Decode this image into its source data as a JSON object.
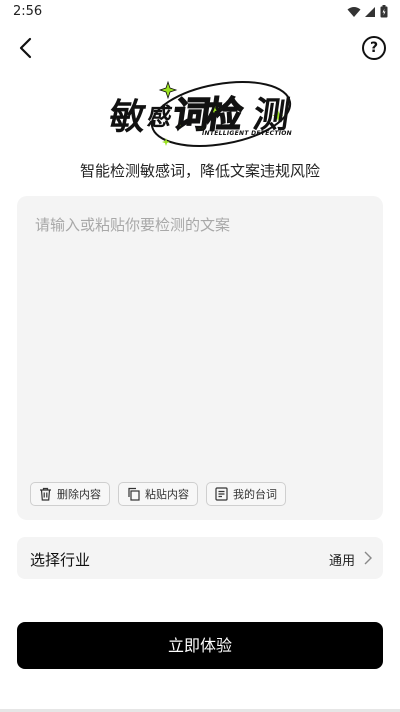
{
  "status_bar": {
    "time": "2:56",
    "icons": [
      "wifi-icon",
      "cell-signal-icon",
      "battery-icon"
    ]
  },
  "header": {
    "back_icon": "chevron-left-icon",
    "help_icon": "question-circle-icon",
    "help_symbol": "?"
  },
  "logo": {
    "char1": "敏",
    "char2": "感",
    "char3": "词检",
    "char4": "测",
    "subtitle": "INTELLIGENT DETECTION"
  },
  "tagline": "智能检测敏感词，降低文案违规风险",
  "editor": {
    "placeholder": "请输入或粘贴你要检测的文案",
    "value": "",
    "buttons": [
      {
        "icon": "trash-icon",
        "label": "删除内容"
      },
      {
        "icon": "copy-icon",
        "label": "粘贴内容"
      },
      {
        "icon": "document-icon",
        "label": "我的台词"
      }
    ]
  },
  "industry": {
    "label": "选择行业",
    "value": "通用"
  },
  "cta": {
    "label": "立即体验"
  },
  "colors": {
    "accent": "#9be21f",
    "cta_bg": "#000000",
    "panel_bg": "#f4f4f4"
  }
}
